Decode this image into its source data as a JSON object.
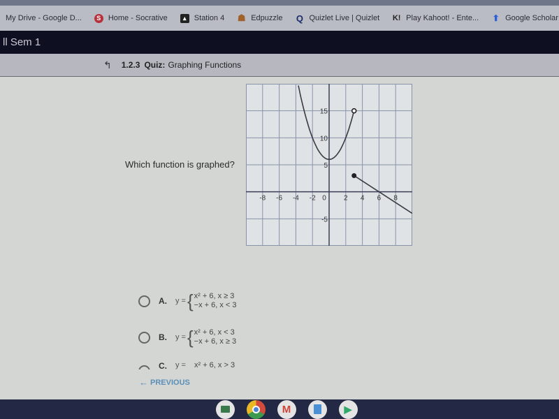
{
  "browser": {
    "url_fragment": "assessment",
    "bookmarks": [
      {
        "label": "My Drive - Google D...",
        "icon": "none"
      },
      {
        "label": "Home - Socrative",
        "icon": "socrative-icon",
        "glyph": "S"
      },
      {
        "label": "Station 4",
        "icon": "station-icon",
        "glyph": "▴"
      },
      {
        "label": "Edpuzzle",
        "icon": "edpuzzle-icon",
        "glyph": "☗"
      },
      {
        "label": "Quizlet Live | Quizlet",
        "icon": "quizlet-icon",
        "glyph": "Q"
      },
      {
        "label": "Play Kahoot! - Ente...",
        "icon": "kahoot-icon",
        "glyph": "K!"
      },
      {
        "label": "Google Scholar",
        "icon": "scholar-icon",
        "glyph": "⬆"
      }
    ]
  },
  "course": {
    "title": "ll Sem 1"
  },
  "quiz": {
    "back_icon": "↰",
    "number": "1.2.3",
    "kind": "Quiz:",
    "title": "Graphing Functions"
  },
  "question": {
    "text": "Which function is graphed?"
  },
  "graph": {
    "x_ticks": [
      "-8",
      "-6",
      "-4",
      "-2",
      "0",
      "2",
      "4",
      "6",
      "8"
    ],
    "y_ticks": [
      "15",
      "10",
      "5",
      "-5"
    ],
    "x_range": [
      -10,
      10
    ],
    "y_range": [
      -10,
      20
    ],
    "pieces": [
      {
        "expr": "x^2 + 6",
        "domain": "x < 3",
        "end_point": [
          3,
          15
        ],
        "end_closed": false
      },
      {
        "expr": "-x + 6",
        "domain": "x >= 3",
        "start_point": [
          3,
          3
        ],
        "start_closed": true
      }
    ],
    "colors": {
      "curve": "#3a3a44",
      "grid": "#8a93a8",
      "axis": "#3a3f55"
    }
  },
  "answers": [
    {
      "letter": "A.",
      "y": "y =",
      "case1": "x² + 6, x ≥ 3",
      "case2": "−x + 6, x < 3"
    },
    {
      "letter": "B.",
      "y": "y =",
      "case1": "x² + 6, x < 3",
      "case2": "−x + 6, x ≥ 3"
    },
    {
      "letter": "C.",
      "y": "y =",
      "case1": "x² + 6, x > 3",
      "case2": ""
    }
  ],
  "nav": {
    "previous_label": "PREVIOUS",
    "previous_icon": "←"
  },
  "shelf": [
    {
      "name": "classroom"
    },
    {
      "name": "chrome"
    },
    {
      "name": "gmail",
      "glyph": "M"
    },
    {
      "name": "docs"
    },
    {
      "name": "play-store",
      "glyph": "▶"
    }
  ]
}
